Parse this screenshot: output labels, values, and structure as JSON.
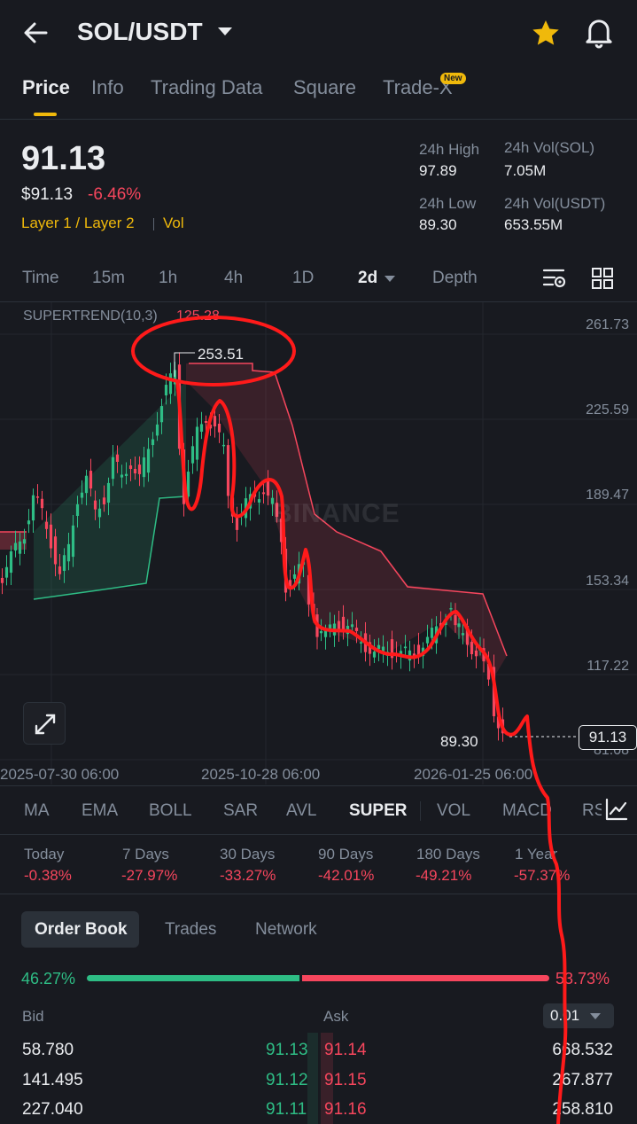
{
  "header": {
    "back_icon": "arrow-left-icon",
    "pair": "SOL/USDT",
    "dropdown_icon": "caret-down-icon",
    "favorite_icon": "star-icon",
    "alert_icon": "bell-icon"
  },
  "tabs": [
    {
      "label": "Price",
      "active": true
    },
    {
      "label": "Info"
    },
    {
      "label": "Trading Data"
    },
    {
      "label": "Square"
    },
    {
      "label": "Trade-X",
      "badge": "New"
    }
  ],
  "ticker": {
    "last": "91.13",
    "usd": "$91.13",
    "change": "-6.46%",
    "tags": [
      "Layer 1 / Layer 2",
      "Vol"
    ],
    "high_label": "24h High",
    "high": "97.89",
    "low_label": "24h Low",
    "low": "89.30",
    "vol_sol_label": "24h Vol(SOL)",
    "vol_sol": "7.05M",
    "vol_usdt_label": "24h Vol(USDT)",
    "vol_usdt": "653.55M"
  },
  "intervals": [
    "Time",
    "15m",
    "1h",
    "4h",
    "1D",
    "2d",
    "Depth"
  ],
  "active_interval": "2d",
  "chart": {
    "indicator_label": "SUPERTREND(10,3)",
    "indicator_value": "125.28",
    "high_marker": "253.51",
    "low_marker": "89.30",
    "current_price_tag": "91.13",
    "watermark": "BINANCE",
    "price_axis": [
      "261.73",
      "225.59",
      "189.47",
      "153.34",
      "117.22",
      "81.08"
    ],
    "date_axis": [
      "2025-07-30 06:00",
      "2025-10-28 06:00",
      "2026-01-25 06:00"
    ],
    "colors": {
      "up": "#2ebd85",
      "down": "#f6465d",
      "annotation": "#ff1a1a"
    }
  },
  "indicators": [
    "MA",
    "EMA",
    "BOLL",
    "SAR",
    "AVL",
    "SUPER",
    "VOL",
    "MACD",
    "RSI"
  ],
  "active_indicator": "SUPER",
  "performance": [
    {
      "label": "Today",
      "value": "-0.38%"
    },
    {
      "label": "7 Days",
      "value": "-27.97%"
    },
    {
      "label": "30 Days",
      "value": "-33.27%"
    },
    {
      "label": "90 Days",
      "value": "-42.01%"
    },
    {
      "label": "180 Days",
      "value": "-49.21%"
    },
    {
      "label": "1 Year",
      "value": "-57.37%"
    }
  ],
  "orderbook": {
    "tabs": [
      "Order Book",
      "Trades",
      "Network"
    ],
    "bid_ratio": "46.27%",
    "ask_ratio": "53.73%",
    "bid_ratio_value": 46.27,
    "bid_header": "Bid",
    "ask_header": "Ask",
    "precision": "0.01",
    "rows": [
      {
        "bid_qty": "58.780",
        "bid_price": "91.13",
        "ask_price": "91.14",
        "ask_qty": "668.532"
      },
      {
        "bid_qty": "141.495",
        "bid_price": "91.12",
        "ask_price": "91.15",
        "ask_qty": "267.877"
      },
      {
        "bid_qty": "227.040",
        "bid_price": "91.11",
        "ask_price": "91.16",
        "ask_qty": "258.810"
      }
    ]
  }
}
